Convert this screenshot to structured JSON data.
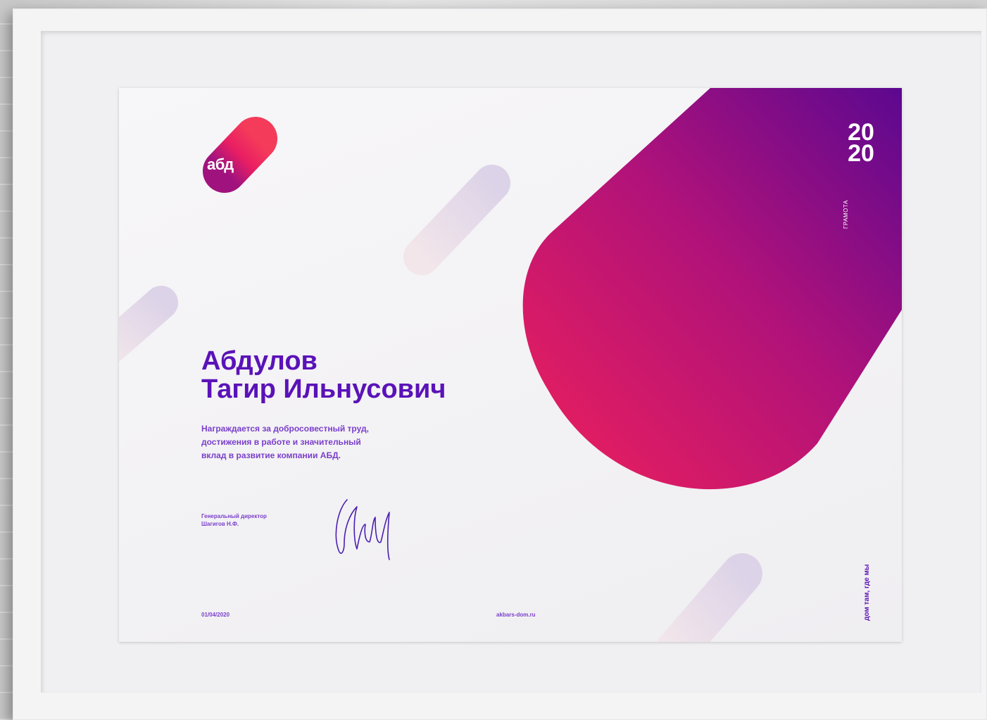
{
  "logo": {
    "text": "абд"
  },
  "certificate": {
    "year_line1": "20",
    "year_line2": "20",
    "doc_type": "ГРАМОТА",
    "name_line1": "Абдулов",
    "name_line2": "Тагир Ильнусович",
    "description_line1": "Награждается за добросовестный труд,",
    "description_line2": "достижения в работе и значительный",
    "description_line3": "вклад в развитие компании АБД.",
    "director_title": "Генеральный директор",
    "director_name": "Шагигов Н.Ф.",
    "date": "01/04/2020",
    "website": "akbars-dom.ru",
    "slogan": "дом там, где мы"
  },
  "colors": {
    "accent_purple": "#5a12b8",
    "gradient_pink": "#f0205a",
    "gradient_violet": "#5c0890",
    "wall": "#d9d9d9",
    "frame": "#f4f4f5"
  }
}
